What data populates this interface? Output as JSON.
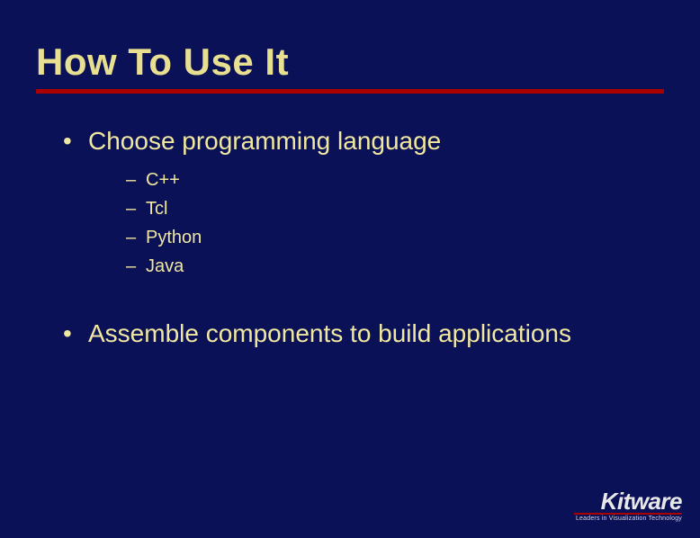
{
  "title": "How To Use It",
  "bullets": {
    "b1": {
      "text": "Choose programming language",
      "sub": {
        "s1": "C++",
        "s2": "Tcl",
        "s3": "Python",
        "s4": "Java"
      }
    },
    "b2": {
      "text": "Assemble components to build applications"
    }
  },
  "logo": {
    "name": "Kitware",
    "tagline": "Leaders in Visualization Technology"
  }
}
